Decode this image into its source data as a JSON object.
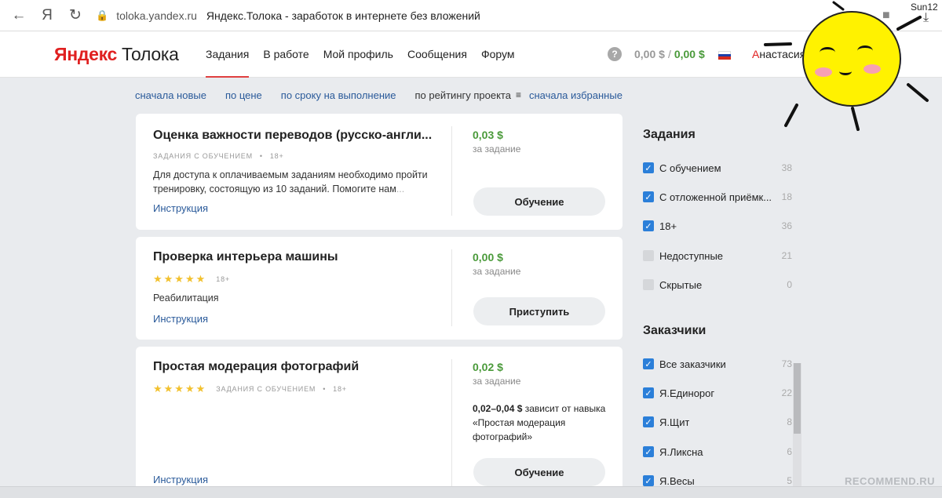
{
  "browser": {
    "back_glyph": "←",
    "yandex_glyph": "Я",
    "reload_glyph": "↻",
    "lock_glyph": "🔒",
    "url": "toloka.yandex.ru",
    "title": "Яндекс.Толока - заработок в интернете без вложений",
    "bookmark_glyph": "■",
    "profile_label": "Sun12",
    "download_glyph": "⤓"
  },
  "site": {
    "logo_red": "Яндекс",
    "logo_black": "Толока",
    "nav": [
      {
        "label": "Задания"
      },
      {
        "label": "В работе"
      },
      {
        "label": "Мой профиль"
      },
      {
        "label": "Сообщения"
      },
      {
        "label": "Форум"
      }
    ],
    "help_glyph": "?",
    "balance_gray": "0,00 $",
    "balance_sep": "/",
    "balance_green": "0,00 $",
    "user_first": "А",
    "user_rest": "настасия Ф"
  },
  "sort": {
    "items": [
      "сначала новые",
      "по цене",
      "по сроку на выполнение"
    ],
    "current": "по рейтингу проекта",
    "current_icon": "≡",
    "last": "сначала избранные"
  },
  "tasks": [
    {
      "title": "Оценка важности переводов (русско-англи...",
      "meta_a": "ЗАДАНИЯ С ОБУЧЕНИЕМ",
      "meta_dot": "•",
      "meta_b": "18+",
      "desc": "Для доступа к оплачиваемым заданиям необходимо пройти тренировку, состоящую из 10 заданий. Помогите нам",
      "desc_fade": "...",
      "instruction": "Инструкция",
      "price": "0,03 $",
      "per_task": "за задание",
      "button": "Обучение"
    },
    {
      "title": "Проверка интерьера машины",
      "stars": "★★★★★",
      "meta_b": "18+",
      "desc": "Реабилитация",
      "instruction": "Инструкция",
      "price": "0,00 $",
      "per_task": "за задание",
      "button": "Приступить"
    },
    {
      "title": "Простая модерация фотографий",
      "stars": "★★★★★",
      "meta_a": "ЗАДАНИЯ С ОБУЧЕНИЕМ",
      "meta_dot": "•",
      "meta_b": "18+",
      "instruction": "Инструкция",
      "price": "0,02 $",
      "per_task": "за задание",
      "price_range": "0,02–0,04 $",
      "price_range_note": "зависит от навыка «Простая модерация фотографий»",
      "button": "Обучение"
    }
  ],
  "filters": {
    "tasks_title": "Задания",
    "tasks": [
      {
        "label": "С обучением",
        "count": "38",
        "checked": true
      },
      {
        "label": "С отложенной приёмк...",
        "count": "18",
        "checked": true
      },
      {
        "label": "18+",
        "count": "36",
        "checked": true
      },
      {
        "label": "Недоступные",
        "count": "21",
        "checked": false
      },
      {
        "label": "Скрытые",
        "count": "0",
        "checked": false
      }
    ],
    "customers_title": "Заказчики",
    "customers": [
      {
        "label": "Все заказчики",
        "count": "73",
        "checked": true
      },
      {
        "label": "Я.Единорог",
        "count": "22",
        "checked": true
      },
      {
        "label": "Я.Щит",
        "count": "8",
        "checked": true
      },
      {
        "label": "Я.Ликсна",
        "count": "6",
        "checked": true
      },
      {
        "label": "Я.Весы",
        "count": "5",
        "checked": true
      }
    ],
    "check_glyph": "✓"
  },
  "watermark": "RECOMMEND.RU",
  "colors": {
    "accent_blue": "#2b7fd9",
    "price_green": "#4a9a3a",
    "logo_red": "#e02020",
    "link_blue": "#2a5a9a",
    "sun_yellow": "#fff200"
  }
}
